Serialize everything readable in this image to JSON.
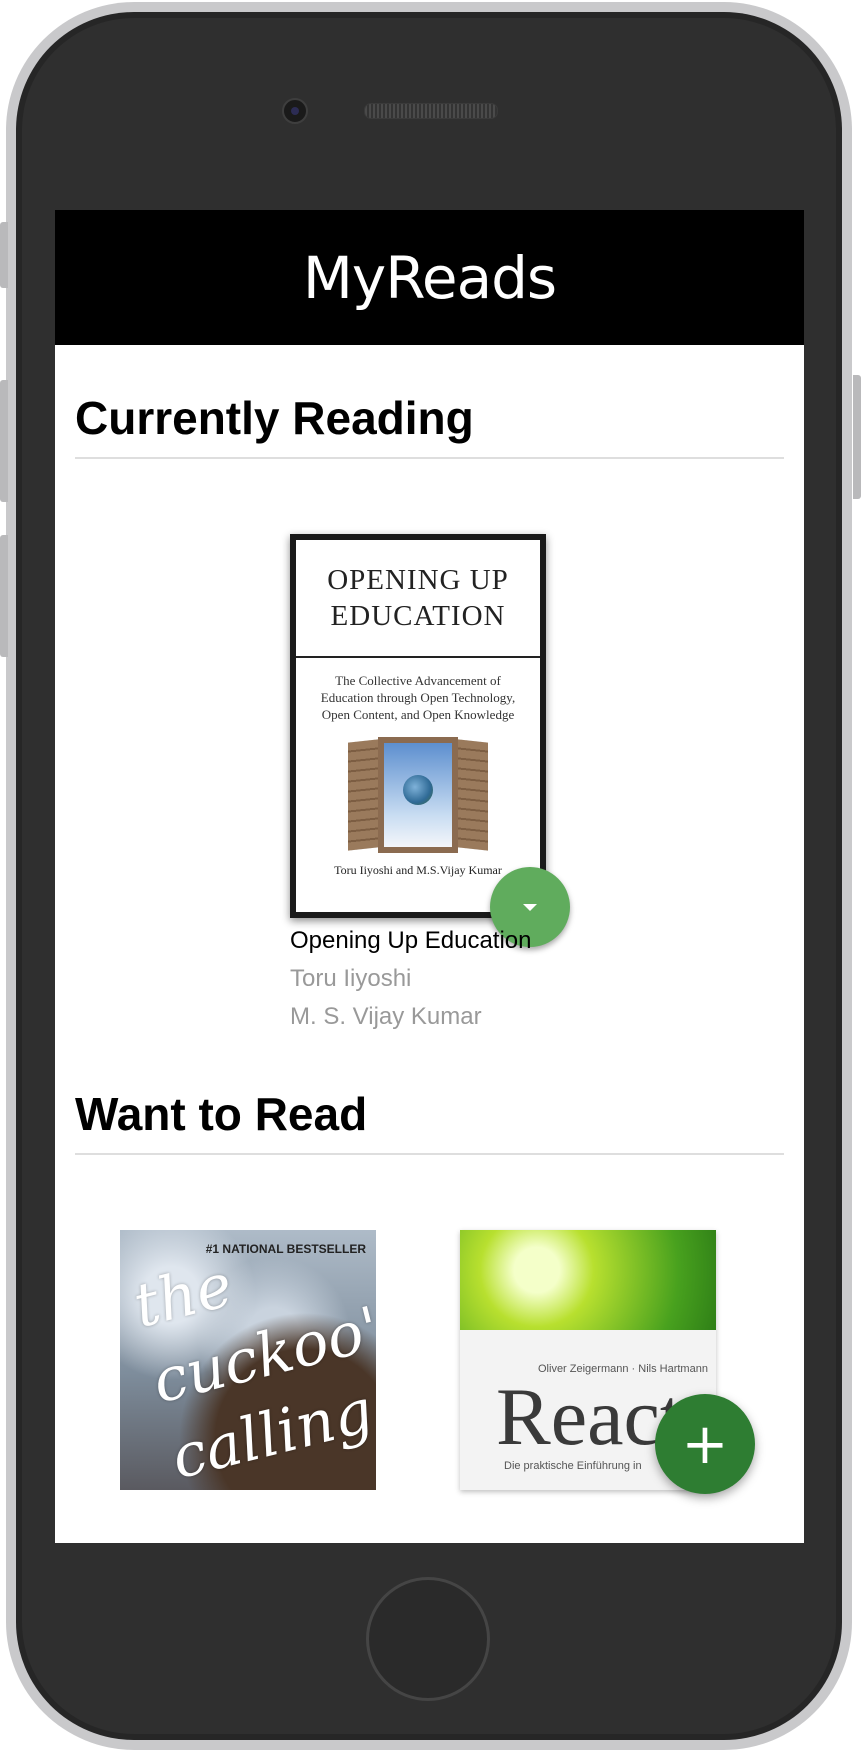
{
  "app": {
    "title": "MyReads"
  },
  "shelves": [
    {
      "title": "Currently Reading",
      "books": [
        {
          "title": "Opening Up Education",
          "authors": [
            "Toru Iiyoshi",
            "M. S. Vijay Kumar"
          ],
          "cover": {
            "line1": "OPENING UP",
            "line2": "EDUCATION",
            "subtitle": "The Collective Advancement of Education through Open Technology, Open Content, and Open Knowledge",
            "credit": "Toru Iiyoshi and M.S.Vijay Kumar"
          }
        }
      ]
    },
    {
      "title": "Want to Read",
      "books": [
        {
          "cover": {
            "tag": "#1 NATIONAL BESTSELLER",
            "script": "the cuckoo's calling"
          }
        },
        {
          "cover": {
            "authors": "Oliver Zeigermann · Nils Hartmann",
            "word": "React",
            "subtitle": "Die praktische Einführung in"
          }
        }
      ]
    }
  ],
  "actions": {
    "add_label": "+",
    "shelf_changer_icon": "caret-down-icon"
  },
  "colors": {
    "header_bg": "#000000",
    "shelf_changer": "#60ac5d",
    "fab": "#2e7d32",
    "author_text": "#999999"
  }
}
